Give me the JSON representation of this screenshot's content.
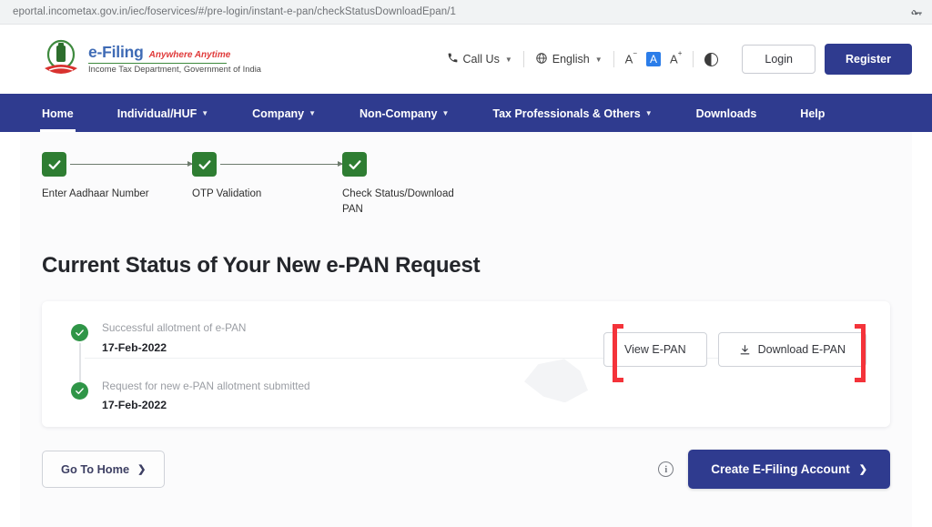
{
  "browser": {
    "url": "eportal.incometax.gov.in/iec/foservices/#/pre-login/instant-e-pan/checkStatusDownloadEpan/1",
    "key_icon": "key-icon"
  },
  "header": {
    "brand_name": "e-Filing",
    "brand_tagline": "Anywhere Anytime",
    "brand_subtitle": "Income Tax Department, Government of India",
    "call_us": "Call Us",
    "language": "English",
    "font_decrease": "A",
    "font_default": "A",
    "font_increase": "A",
    "contrast_icon": "contrast-toggle-icon",
    "login_label": "Login",
    "register_label": "Register"
  },
  "nav": {
    "items": [
      {
        "label": "Home",
        "has_chevron": false,
        "active": true
      },
      {
        "label": "Individual/HUF",
        "has_chevron": true,
        "active": false
      },
      {
        "label": "Company",
        "has_chevron": true,
        "active": false
      },
      {
        "label": "Non-Company",
        "has_chevron": true,
        "active": false
      },
      {
        "label": "Tax Professionals & Others",
        "has_chevron": true,
        "active": false
      },
      {
        "label": "Downloads",
        "has_chevron": false,
        "active": false
      },
      {
        "label": "Help",
        "has_chevron": false,
        "active": false
      }
    ]
  },
  "stepper": {
    "steps": [
      {
        "label": "Enter Aadhaar Number",
        "state": "complete"
      },
      {
        "label": "OTP Validation",
        "state": "complete"
      },
      {
        "label": "Check Status/Download PAN",
        "state": "complete"
      }
    ]
  },
  "main": {
    "title": "Current Status of Your New e-PAN Request",
    "timeline": [
      {
        "description": "Successful allotment of e-PAN",
        "date": "17-Feb-2022"
      },
      {
        "description": "Request for new e-PAN allotment submitted",
        "date": "17-Feb-2022"
      }
    ],
    "actions": {
      "view_epan": "View E-PAN",
      "download_epan": "Download E-PAN",
      "download_icon": "download-icon"
    },
    "footer": {
      "go_home": "Go To Home",
      "create_account": "Create E-Filing Account",
      "info_icon": "info-icon"
    }
  },
  "colors": {
    "navy": "#2f3b8f",
    "green": "#2e7d32",
    "timeline_green": "#2f9547",
    "annotation_red": "#f4333a",
    "page_bg": "#f5f6f8"
  }
}
